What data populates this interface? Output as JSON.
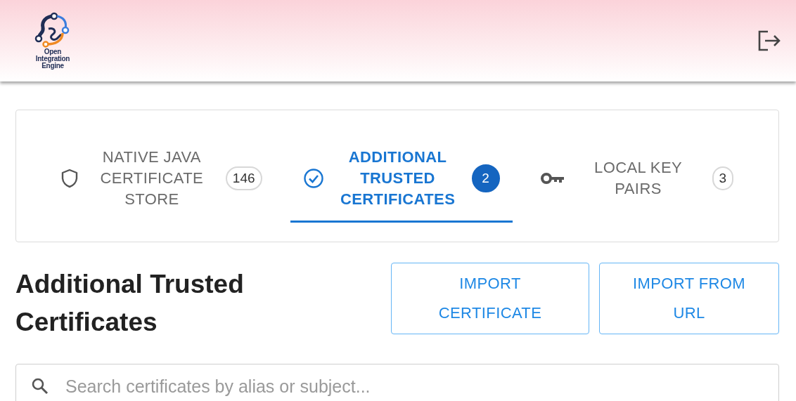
{
  "header": {
    "logo_text": [
      "Open",
      "Integration",
      "Engine"
    ]
  },
  "tabs": [
    {
      "kind": "shield",
      "label": "NATIVE JAVA CERTIFICATE STORE",
      "count": "146",
      "selected": false
    },
    {
      "kind": "check",
      "label": "ADDITIONAL TRUSTED CERTIFICATES",
      "count": "2",
      "selected": true
    },
    {
      "kind": "key",
      "label": "LOCAL KEY PAIRS",
      "count": "3",
      "selected": false
    }
  ],
  "page": {
    "title": "Additional Trusted Certificates"
  },
  "buttons": [
    "IMPORT CERTIFICATE",
    "IMPORT FROM URL"
  ],
  "search": {
    "placeholder": "Search certificates by alias or subject..."
  }
}
